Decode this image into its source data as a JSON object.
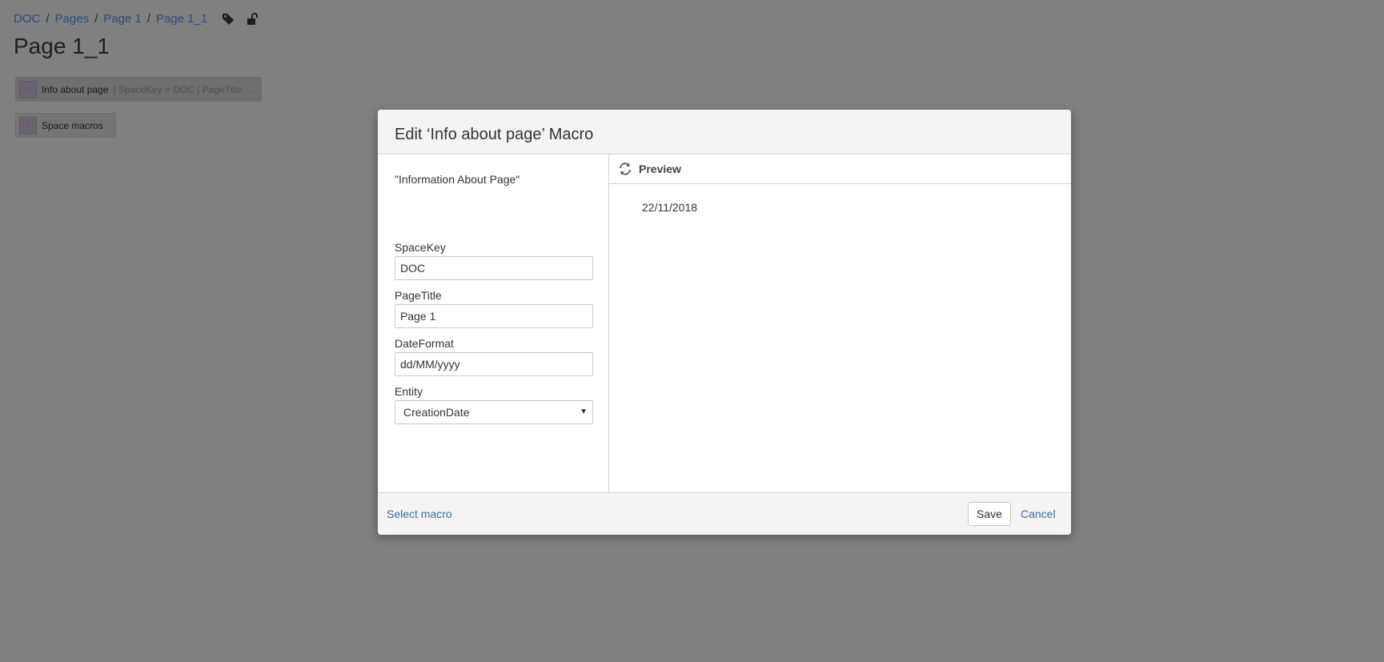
{
  "breadcrumb": {
    "items": [
      "DOC",
      "Pages",
      "Page 1",
      "Page 1_1"
    ],
    "separator": "/",
    "icons": [
      "tag-icon",
      "unlock-icon"
    ]
  },
  "page": {
    "title": "Page 1_1",
    "macros": [
      {
        "name": "Info about page",
        "params": " | SpaceKey = DOC | PageTitle ..."
      },
      {
        "name": "Space macros",
        "params": ""
      }
    ]
  },
  "dialog": {
    "title": "Edit ‘Info about page’ Macro",
    "description": "\"Information About Page\"",
    "fields": {
      "space_key": {
        "label": "SpaceKey",
        "value": "DOC"
      },
      "page_title": {
        "label": "PageTitle",
        "value": "Page 1"
      },
      "date_format": {
        "label": "DateFormat",
        "value": "dd/MM/yyyy"
      },
      "entity": {
        "label": "Entity",
        "value": "CreationDate"
      }
    },
    "preview": {
      "label": "Preview",
      "value": "22/11/2018"
    },
    "footer": {
      "select_macro": "Select macro",
      "save": "Save",
      "cancel": "Cancel"
    }
  },
  "colors": {
    "overlay": "#808080",
    "link": "#3b6ea5",
    "dialog_header": "#f4f4f4"
  }
}
